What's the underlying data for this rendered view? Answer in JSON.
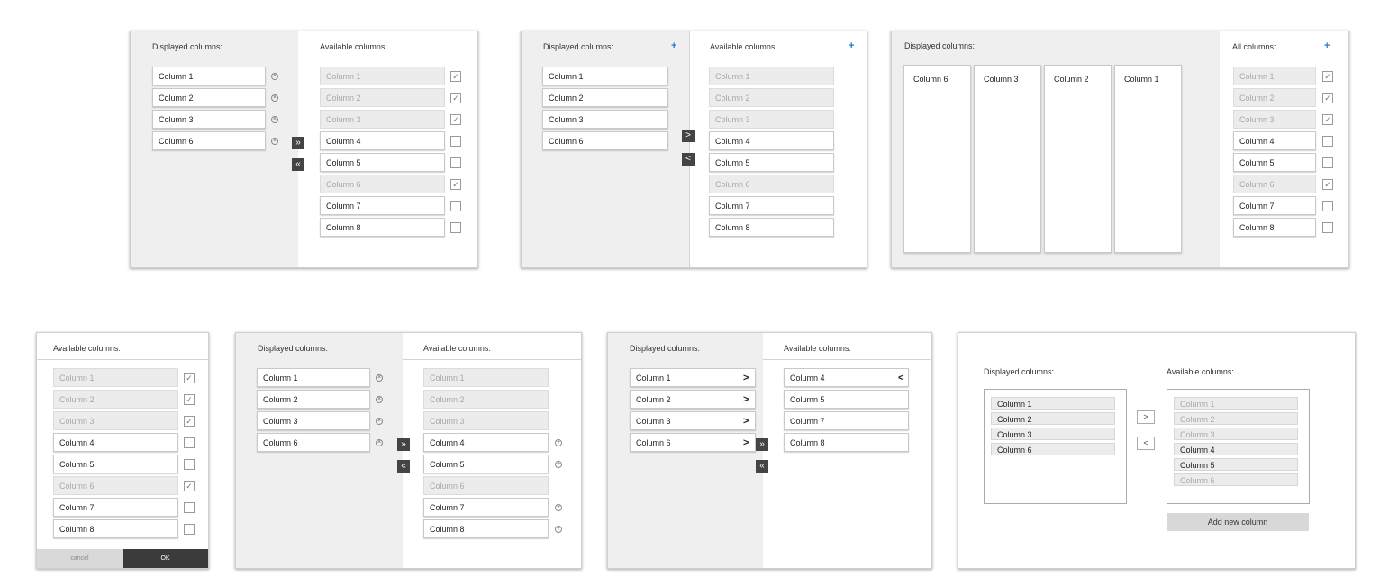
{
  "labels": {
    "displayed": "Displayed columns:",
    "available": "Available columns:",
    "all": "All columns:",
    "plus": "+",
    "cancel": "cancel",
    "ok": "OK",
    "add_new": "Add new column"
  },
  "p1": {
    "displayed": [
      "Column 1",
      "Column 2",
      "Column 3",
      "Column 6"
    ],
    "available": [
      {
        "label": "Column 1",
        "checked": true
      },
      {
        "label": "Column 2",
        "checked": true
      },
      {
        "label": "Column 3",
        "checked": true
      },
      {
        "label": "Column 4",
        "checked": false
      },
      {
        "label": "Column 5",
        "checked": false
      },
      {
        "label": "Column 6",
        "checked": true
      },
      {
        "label": "Column 7",
        "checked": false
      },
      {
        "label": "Column 8",
        "checked": false
      }
    ]
  },
  "p2": {
    "displayed": [
      "Column 1",
      "Column 2",
      "Column 3",
      "Column 6"
    ],
    "available": [
      "Column 1",
      "Column 2",
      "Column 3",
      "Column 4",
      "Column 5",
      "Column 6",
      "Column 7",
      "Column 8"
    ]
  },
  "p3": {
    "cards": [
      "Column 6",
      "Column 3",
      "Column 2",
      "Column 1"
    ],
    "all": [
      {
        "label": "Column 1",
        "checked": true
      },
      {
        "label": "Column 2",
        "checked": true
      },
      {
        "label": "Column 3",
        "checked": true
      },
      {
        "label": "Column 4",
        "checked": false
      },
      {
        "label": "Column 5",
        "checked": false
      },
      {
        "label": "Column 6",
        "checked": true
      },
      {
        "label": "Column 7",
        "checked": false
      },
      {
        "label": "Column 8",
        "checked": false
      }
    ]
  },
  "p4": {
    "available": [
      {
        "label": "Column 1",
        "checked": true
      },
      {
        "label": "Column 2",
        "checked": true
      },
      {
        "label": "Column 3",
        "checked": true
      },
      {
        "label": "Column 4",
        "checked": false
      },
      {
        "label": "Column 5",
        "checked": false
      },
      {
        "label": "Column 6",
        "checked": true
      },
      {
        "label": "Column 7",
        "checked": false
      },
      {
        "label": "Column 8",
        "checked": false
      }
    ]
  },
  "p5": {
    "displayed": [
      "Column 1",
      "Column 2",
      "Column 3",
      "Column 6"
    ],
    "available": [
      "Column 1",
      "Column 2",
      "Column 3",
      "Column 4",
      "Column 5",
      "Column 6",
      "Column 7",
      "Column 8"
    ]
  },
  "p6": {
    "displayed": [
      "Column 1",
      "Column 2",
      "Column 3",
      "Column 6"
    ],
    "available": [
      "Column 4",
      "Column 5",
      "Column 7",
      "Column 8"
    ]
  },
  "p7": {
    "displayed": [
      "Column 1",
      "Column 2",
      "Column 3",
      "Column 6"
    ],
    "available": [
      "Column 1",
      "Column 2",
      "Column 3",
      "Column 4",
      "Column 5",
      "Column 6"
    ]
  },
  "icons": {
    "double_right": "»",
    "double_left": "«",
    "single_right": ">",
    "single_left": "<",
    "check": "✓",
    "x_circle": "×",
    "plus_circle": "+"
  }
}
